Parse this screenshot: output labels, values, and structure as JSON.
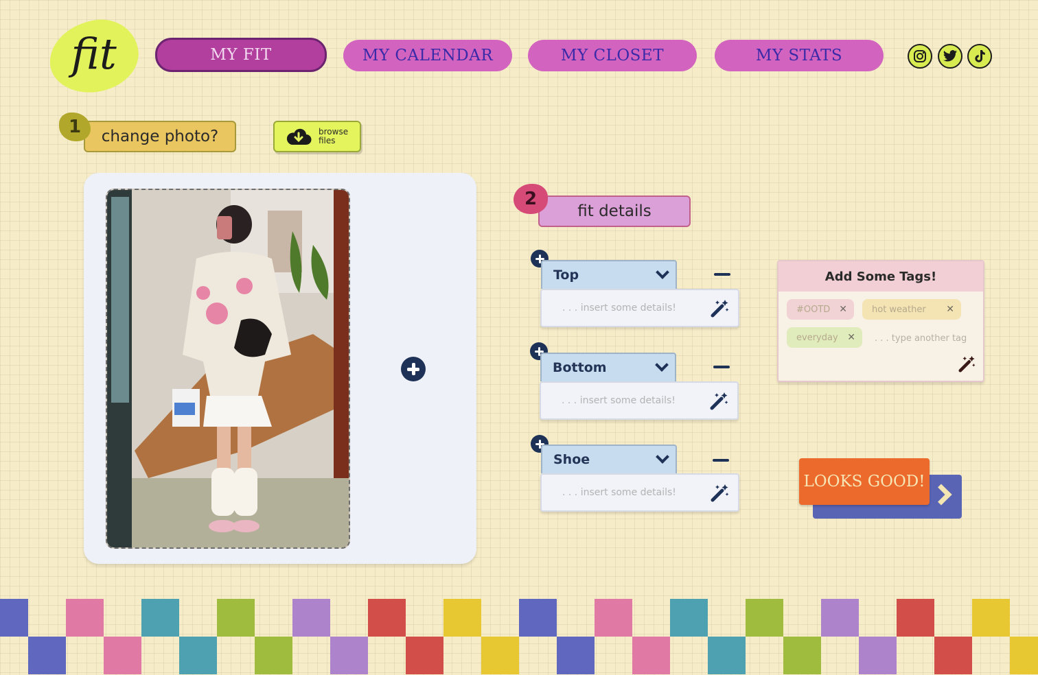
{
  "logo": {
    "text": "fit"
  },
  "nav": [
    {
      "label": "MY FIT",
      "active": true
    },
    {
      "label": "MY CALENDAR",
      "active": false
    },
    {
      "label": "MY CLOSET",
      "active": false
    },
    {
      "label": "MY STATS",
      "active": false
    }
  ],
  "social": [
    "instagram-icon",
    "twitter-icon",
    "tiktok-icon"
  ],
  "step1": {
    "number": "1",
    "label": "change photo?",
    "browse_line1": "browse",
    "browse_line2": "files"
  },
  "step2": {
    "number": "2",
    "label": "fit details"
  },
  "items": [
    {
      "label": "Top",
      "placeholder": ". . . insert some details!"
    },
    {
      "label": "Bottom",
      "placeholder": ". . . insert some details!"
    },
    {
      "label": "Shoe",
      "placeholder": ". . . insert some details!"
    }
  ],
  "tags": {
    "title": "Add Some Tags!",
    "list": [
      {
        "label": "#OOTD",
        "color": "#f1d3d6"
      },
      {
        "label": "hot weather",
        "color": "#f4e3b3"
      },
      {
        "label": "everyday",
        "color": "#e1ecbd"
      }
    ],
    "placeholder": ". . . type another tag"
  },
  "submit": {
    "label": "LOOKS GOOD!"
  },
  "colors": {
    "background": "#f6ecc8",
    "nav": "#d264c0",
    "nav_active": "#b23f9e",
    "accent_lime": "#e2f25a",
    "navy": "#1e3258",
    "orange": "#ec6a2c",
    "checker": [
      "#5f67bf",
      "#e07aa4",
      "#4ea1b0",
      "#9fbc3e",
      "#ad84cc",
      "#d24e48",
      "#e8c832"
    ]
  }
}
